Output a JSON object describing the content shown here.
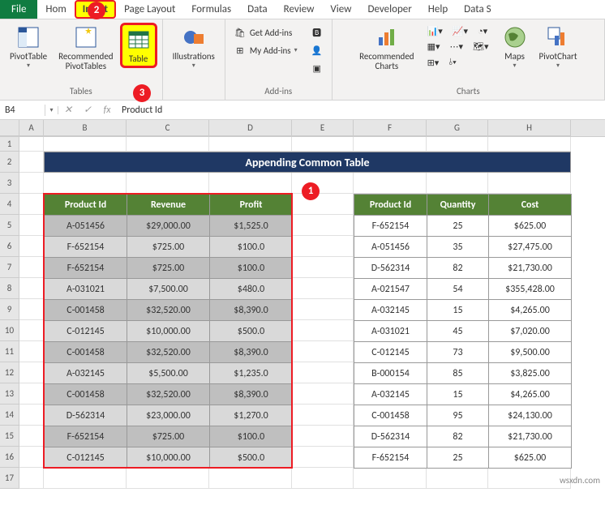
{
  "menu": {
    "file": "File",
    "tabs": [
      "Hom",
      "Insert",
      "Page Layout",
      "Formulas",
      "Data",
      "Review",
      "View",
      "Developer",
      "Help",
      "Data S"
    ]
  },
  "ribbon": {
    "tables": {
      "label": "Tables",
      "pivottable": "PivotTable",
      "recommended": "Recommended\nPivotTables",
      "table": "Table"
    },
    "illustrations": {
      "label": "Illustrations"
    },
    "addins": {
      "label": "Add-ins",
      "get": "Get Add-ins",
      "my": "My Add-ins"
    },
    "charts": {
      "label": "Charts",
      "recommended": "Recommended\nCharts",
      "maps": "Maps",
      "pivotchart": "PivotChart"
    }
  },
  "namebox": "B4",
  "formula": "Product Id",
  "title": "Appending Common Table",
  "columns": [
    "A",
    "B",
    "C",
    "D",
    "E",
    "F",
    "G",
    "H"
  ],
  "rows": [
    "1",
    "2",
    "3",
    "4",
    "5",
    "6",
    "7",
    "8",
    "9",
    "10",
    "11",
    "12",
    "13",
    "14",
    "15",
    "16",
    "17"
  ],
  "table1": {
    "headers": [
      "Product Id",
      "Revenue",
      "Profit"
    ],
    "rows": [
      [
        "A-051456",
        "$29,000.00",
        "$1,525.0"
      ],
      [
        "F-652154",
        "$725.00",
        "$100.0"
      ],
      [
        "F-652154",
        "$725.00",
        "$100.0"
      ],
      [
        "A-031021",
        "$7,500.00",
        "$480.0"
      ],
      [
        "C-001458",
        "$32,520.00",
        "$8,390.0"
      ],
      [
        "C-012145",
        "$10,000.00",
        "$500.0"
      ],
      [
        "C-001458",
        "$32,520.00",
        "$8,390.0"
      ],
      [
        "A-032145",
        "$5,500.00",
        "$1,235.0"
      ],
      [
        "C-001458",
        "$32,520.00",
        "$8,390.0"
      ],
      [
        "D-562314",
        "$23,000.00",
        "$1,270.0"
      ],
      [
        "F-652154",
        "$725.00",
        "$100.0"
      ],
      [
        "C-012145",
        "$10,000.00",
        "$500.0"
      ]
    ]
  },
  "table2": {
    "headers": [
      "Product Id",
      "Quantity",
      "Cost"
    ],
    "rows": [
      [
        "F-652154",
        "25",
        "$625.00"
      ],
      [
        "A-051456",
        "35",
        "$27,475.00"
      ],
      [
        "D-562314",
        "82",
        "$21,730.00"
      ],
      [
        "A-021547",
        "54",
        "$355,428.00"
      ],
      [
        "A-032145",
        "15",
        "$4,265.00"
      ],
      [
        "A-031021",
        "45",
        "$7,020.00"
      ],
      [
        "C-012145",
        "73",
        "$9,500.00"
      ],
      [
        "B-000154",
        "85",
        "$3,825.00"
      ],
      [
        "A-032145",
        "15",
        "$4,265.00"
      ],
      [
        "C-001458",
        "95",
        "$24,130.00"
      ],
      [
        "D-562314",
        "82",
        "$21,730.00"
      ],
      [
        "F-652154",
        "25",
        "$625.00"
      ]
    ]
  },
  "badges": {
    "b1": "1",
    "b2": "2",
    "b3": "3"
  },
  "watermark": "wsxdn.com"
}
